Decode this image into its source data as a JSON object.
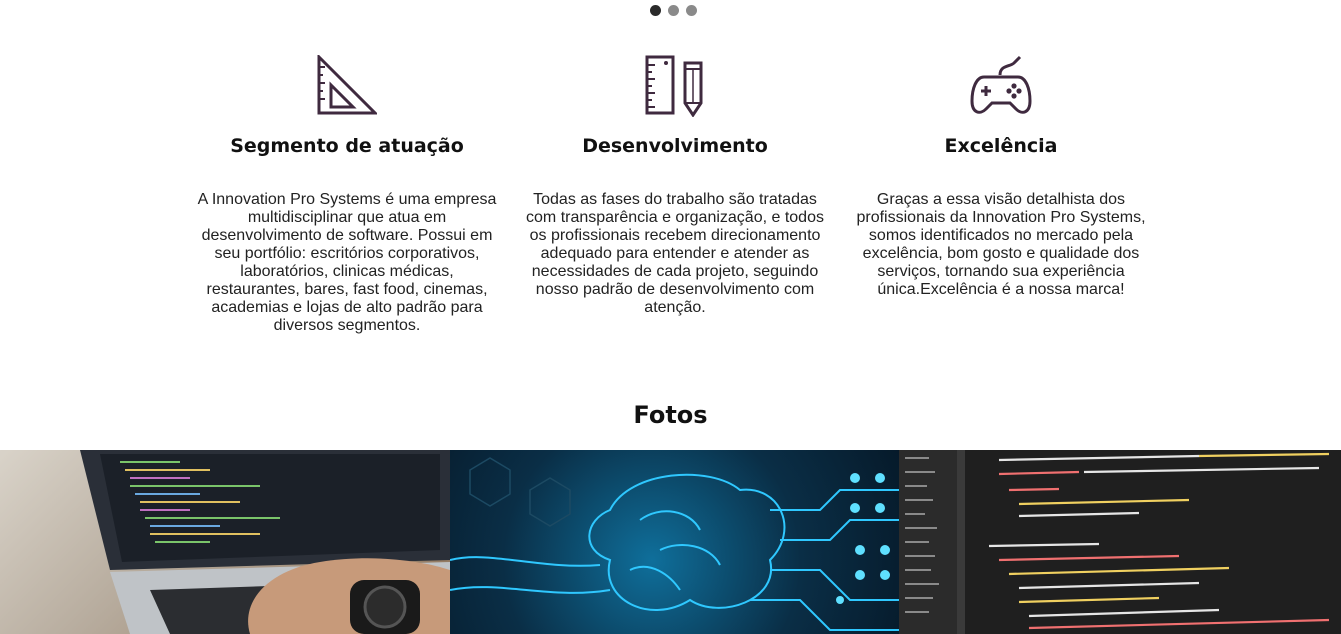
{
  "carousel": {
    "dots": 3,
    "active_index": 0
  },
  "features": [
    {
      "icon": "set-square-ruler-icon",
      "title": "Segmento de atuação",
      "text": "A Innovation Pro Systems é uma empresa multidisciplinar que atua em desenvolvimento de software. Possui em seu portfólio: escritórios corporativos, laboratórios, clinicas médicas, restaurantes, bares, fast food, cinemas, academias e lojas de alto padrão para diversos segmentos."
    },
    {
      "icon": "ruler-pencil-icon",
      "title": "Desenvolvimento",
      "text": "Todas as fases do trabalho são tratadas com transparência e organização, e todos os profissionais recebem direcionamento adequado para entender e atender as necessidades de cada projeto, seguindo nosso padrão de desenvolvimento com atenção."
    },
    {
      "icon": "gamepad-icon",
      "title": "Excelência",
      "text": "Graças a essa visão detalhista dos profissionais da Innovation Pro Systems, somos identificados no mercado pela excelência, bom gosto e qualidade dos serviços, tornando sua experiência única.Excelência é a nossa marca!"
    }
  ],
  "photos_section": {
    "title": "Fotos"
  },
  "colors": {
    "icon_stroke": "#3f2a3f",
    "code_bg": "#1f1f1f",
    "circuit_blue": "#2fc8ff"
  }
}
